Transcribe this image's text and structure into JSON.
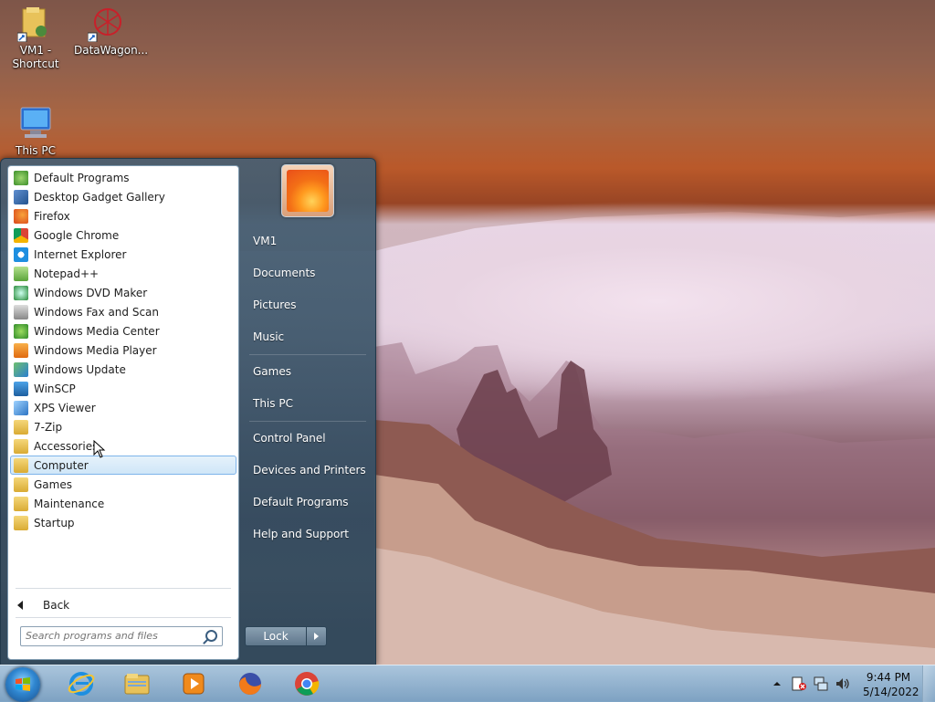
{
  "desktop": {
    "icons": [
      {
        "label": "VM1 -\nShortcut"
      },
      {
        "label": "DataWagon..."
      },
      {
        "label": "This PC"
      }
    ]
  },
  "start_menu": {
    "programs": [
      {
        "label": "Default Programs",
        "icon": "default-programs-icon"
      },
      {
        "label": "Desktop Gadget Gallery",
        "icon": "gadget-icon"
      },
      {
        "label": "Firefox",
        "icon": "firefox-icon"
      },
      {
        "label": "Google Chrome",
        "icon": "chrome-icon"
      },
      {
        "label": "Internet Explorer",
        "icon": "ie-icon"
      },
      {
        "label": "Notepad++",
        "icon": "notepad-icon"
      },
      {
        "label": "Windows DVD Maker",
        "icon": "dvd-icon"
      },
      {
        "label": "Windows Fax and Scan",
        "icon": "fax-icon"
      },
      {
        "label": "Windows Media Center",
        "icon": "media-center-icon"
      },
      {
        "label": "Windows Media Player",
        "icon": "media-player-icon"
      },
      {
        "label": "Windows Update",
        "icon": "update-icon"
      },
      {
        "label": "WinSCP",
        "icon": "winscp-icon"
      },
      {
        "label": "XPS Viewer",
        "icon": "xps-icon"
      },
      {
        "label": "7-Zip",
        "icon": "folder-icon"
      },
      {
        "label": "Accessories",
        "icon": "folder-icon"
      },
      {
        "label": "Computer",
        "icon": "folder-icon"
      },
      {
        "label": "Games",
        "icon": "folder-icon"
      },
      {
        "label": "Maintenance",
        "icon": "folder-icon"
      },
      {
        "label": "Startup",
        "icon": "folder-icon"
      }
    ],
    "selected_program": "Computer",
    "back_label": "Back",
    "search_placeholder": "Search programs and files",
    "right_items": [
      {
        "label": "VM1"
      },
      {
        "label": "Documents"
      },
      {
        "label": "Pictures"
      },
      {
        "label": "Music"
      },
      {
        "label": "Games"
      },
      {
        "label": "This PC"
      },
      {
        "label": "Control Panel"
      },
      {
        "label": "Devices and Printers"
      },
      {
        "label": "Default Programs"
      },
      {
        "label": "Help and Support"
      }
    ],
    "lock_label": "Lock"
  },
  "taskbar": {
    "pinned": [
      "ie-icon",
      "explorer-icon",
      "media-player-icon",
      "firefox-icon",
      "chrome-icon"
    ],
    "clock_time": "9:44 PM",
    "clock_date": "5/14/2022"
  },
  "colors": {
    "taskbar": "#8fb3d4",
    "start_menu": "#3f5b70",
    "selection": "#cfe6f8"
  }
}
